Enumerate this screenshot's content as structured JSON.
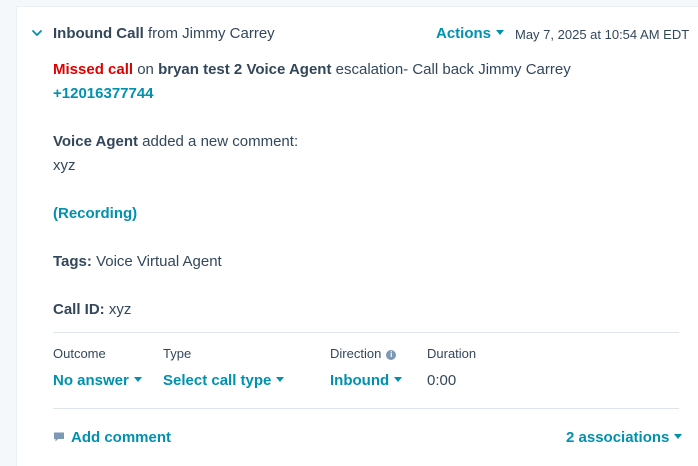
{
  "header": {
    "call_type": "Inbound Call",
    "from_text": " from Jimmy Carrey",
    "actions_label": "Actions",
    "timestamp": "May 7, 2025 at 10:54 AM EDT"
  },
  "summary": {
    "missed_label": "Missed call",
    "on_text": " on ",
    "agent_name": "bryan test 2 Voice Agent",
    "escalation_text": " escalation- Call back Jimmy Carrey",
    "phone": "+12016377744"
  },
  "comment": {
    "author": "Voice Agent",
    "action_text": " added a new comment:",
    "text": "xyz"
  },
  "recording_label": "(Recording)",
  "tags": {
    "label": "Tags:",
    "value": " Voice Virtual Agent"
  },
  "call_id": {
    "label": "Call ID:",
    "value": " xyz"
  },
  "properties": {
    "outcome": {
      "label": "Outcome",
      "value": "No answer"
    },
    "type": {
      "label": "Type",
      "value": "Select call type"
    },
    "direction": {
      "label": "Direction",
      "value": "Inbound"
    },
    "duration": {
      "label": "Duration",
      "value": "0:00"
    }
  },
  "footer": {
    "add_comment_label": "Add comment",
    "associations_label": "2 associations"
  },
  "colors": {
    "link": "#0091ae",
    "missed": "#e00000",
    "text": "#33475b"
  },
  "icons": {
    "expand": "chevron-down-icon",
    "direction_info": "info-icon",
    "comment": "comment-icon"
  }
}
